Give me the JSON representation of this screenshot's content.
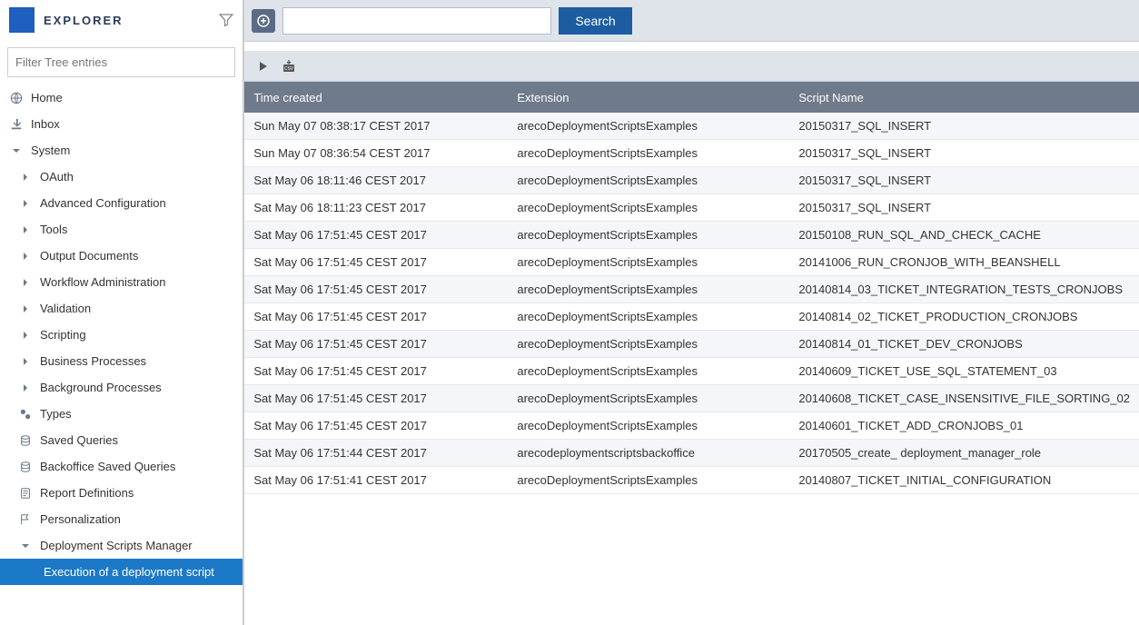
{
  "header": {
    "title": "EXPLORER",
    "filter_placeholder": "Filter Tree entries"
  },
  "nav": {
    "home": "Home",
    "inbox": "Inbox",
    "system": "System",
    "items": [
      "OAuth",
      "Advanced Configuration",
      "Tools",
      "Output Documents",
      "Workflow Administration",
      "Validation",
      "Scripting",
      "Business Processes",
      "Background Processes"
    ],
    "types": "Types",
    "saved_queries": "Saved Queries",
    "backoffice_saved_queries": "Backoffice Saved Queries",
    "report_definitions": "Report Definitions",
    "personalization": "Personalization",
    "dsm": "Deployment Scripts Manager",
    "dsm_sub": "Execution of a deployment script"
  },
  "toolbar": {
    "search_label": "Search"
  },
  "table": {
    "headers": {
      "time": "Time created",
      "extension": "Extension",
      "script": "Script Name"
    },
    "rows": [
      {
        "time": "Sun May 07 08:38:17 CEST 2017",
        "extension": "arecoDeploymentScriptsExamples",
        "script": "20150317_SQL_INSERT"
      },
      {
        "time": "Sun May 07 08:36:54 CEST 2017",
        "extension": "arecoDeploymentScriptsExamples",
        "script": "20150317_SQL_INSERT"
      },
      {
        "time": "Sat May 06 18:11:46 CEST 2017",
        "extension": "arecoDeploymentScriptsExamples",
        "script": "20150317_SQL_INSERT"
      },
      {
        "time": "Sat May 06 18:11:23 CEST 2017",
        "extension": "arecoDeploymentScriptsExamples",
        "script": "20150317_SQL_INSERT"
      },
      {
        "time": "Sat May 06 17:51:45 CEST 2017",
        "extension": "arecoDeploymentScriptsExamples",
        "script": "20150108_RUN_SQL_AND_CHECK_CACHE"
      },
      {
        "time": "Sat May 06 17:51:45 CEST 2017",
        "extension": "arecoDeploymentScriptsExamples",
        "script": "20141006_RUN_CRONJOB_WITH_BEANSHELL"
      },
      {
        "time": "Sat May 06 17:51:45 CEST 2017",
        "extension": "arecoDeploymentScriptsExamples",
        "script": "20140814_03_TICKET_INTEGRATION_TESTS_CRONJOBS"
      },
      {
        "time": "Sat May 06 17:51:45 CEST 2017",
        "extension": "arecoDeploymentScriptsExamples",
        "script": "20140814_02_TICKET_PRODUCTION_CRONJOBS"
      },
      {
        "time": "Sat May 06 17:51:45 CEST 2017",
        "extension": "arecoDeploymentScriptsExamples",
        "script": "20140814_01_TICKET_DEV_CRONJOBS"
      },
      {
        "time": "Sat May 06 17:51:45 CEST 2017",
        "extension": "arecoDeploymentScriptsExamples",
        "script": "20140609_TICKET_USE_SQL_STATEMENT_03"
      },
      {
        "time": "Sat May 06 17:51:45 CEST 2017",
        "extension": "arecoDeploymentScriptsExamples",
        "script": "20140608_TICKET_CASE_INSENSITIVE_FILE_SORTING_02"
      },
      {
        "time": "Sat May 06 17:51:45 CEST 2017",
        "extension": "arecoDeploymentScriptsExamples",
        "script": "20140601_TICKET_ADD_CRONJOBS_01"
      },
      {
        "time": "Sat May 06 17:51:44 CEST 2017",
        "extension": "arecodeploymentscriptsbackoffice",
        "script": "20170505_create_ deployment_manager_role"
      },
      {
        "time": "Sat May 06 17:51:41 CEST 2017",
        "extension": "arecoDeploymentScriptsExamples",
        "script": "20140807_TICKET_INITIAL_CONFIGURATION"
      }
    ]
  }
}
